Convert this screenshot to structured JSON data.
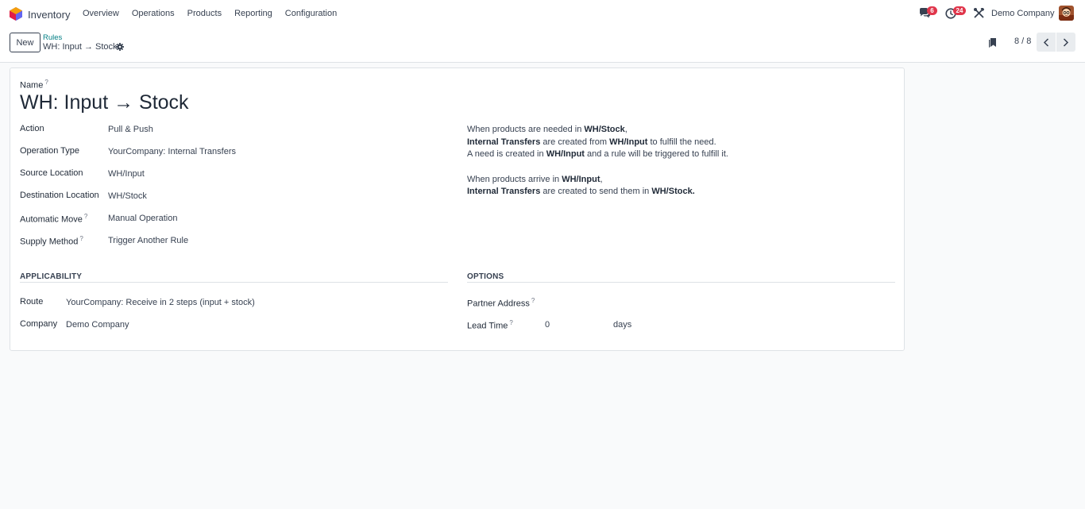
{
  "app": {
    "name": "Inventory",
    "logo_icon": "inventory-app-icon"
  },
  "menu": {
    "items": [
      "Overview",
      "Operations",
      "Products",
      "Reporting",
      "Configuration"
    ]
  },
  "systray": {
    "chat_count": "6",
    "activity_count": "24",
    "company": "Demo Company"
  },
  "control_panel": {
    "new_label": "New",
    "breadcrumb_parent": "Rules",
    "breadcrumb_current": "WH: Input → Stock",
    "pager_value": "8 / 8"
  },
  "form": {
    "name_label": "Name",
    "name_value": "WH: Input → Stock",
    "help_mark": "?",
    "fields": {
      "action": {
        "label": "Action",
        "value": "Pull & Push"
      },
      "operation_type": {
        "label": "Operation Type",
        "value": "YourCompany: Internal Transfers"
      },
      "source_location": {
        "label": "Source Location",
        "value": "WH/Input"
      },
      "destination_location": {
        "label": "Destination Location",
        "value": "WH/Stock"
      },
      "automatic_move": {
        "label": "Automatic Move",
        "value": "Manual Operation"
      },
      "supply_method": {
        "label": "Supply Method",
        "value": "Trigger Another Rule"
      }
    },
    "description": {
      "l1_a": "When products are needed in ",
      "l1_b": "WH/Stock",
      "l1_c": ",",
      "l2_a": "Internal Transfers",
      "l2_b": " are created from ",
      "l2_c": "WH/Input",
      "l2_d": " to fulfill the need.",
      "l3_a": "A need is created in ",
      "l3_b": "WH/Input",
      "l3_c": " and a rule will be triggered to fulfill it.",
      "l4_a": "When products arrive in ",
      "l4_b": "WH/Input",
      "l4_c": ",",
      "l5_a": "Internal Transfers",
      "l5_b": " are created to send them in ",
      "l5_c": "WH/Stock."
    },
    "applicability": {
      "title": "APPLICABILITY",
      "route_label": "Route",
      "route_value": "YourCompany: Receive in 2 steps (input + stock)",
      "company_label": "Company",
      "company_value": "Demo Company"
    },
    "options": {
      "title": "OPTIONS",
      "partner_label": "Partner Address",
      "partner_value": "",
      "lead_time_label": "Lead Time",
      "lead_time_value": "0",
      "lead_time_unit": "days"
    }
  }
}
